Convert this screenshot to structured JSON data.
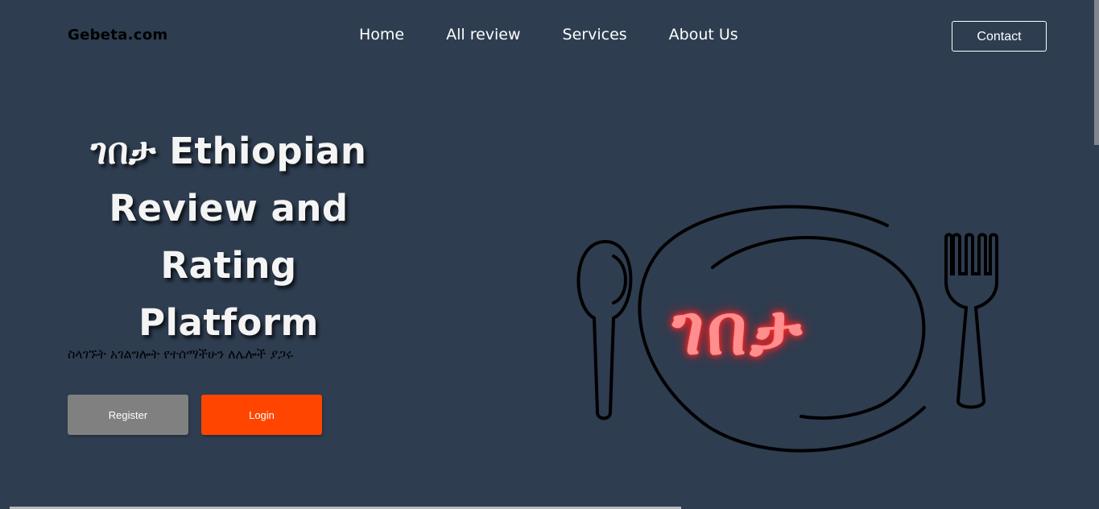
{
  "header": {
    "brand": "Gebeta.com",
    "nav": [
      "Home",
      "All review",
      "Services",
      "About Us"
    ],
    "contact_label": "Contact"
  },
  "hero": {
    "title_line1": "ገበታ Ethiopian",
    "title_line2": "Review and",
    "title_line3": "Rating Platform",
    "tagline": "ስላገኙት አገልግሎት የተሰማችሁን ለሌሎች ያጋሩ",
    "register_label": "Register",
    "login_label": "Login"
  },
  "logo": {
    "text": "ገበታ",
    "glow_color": "#ff2a2a"
  },
  "colors": {
    "background": "#2e3d50",
    "register": "#808080",
    "login": "#ff4500"
  }
}
